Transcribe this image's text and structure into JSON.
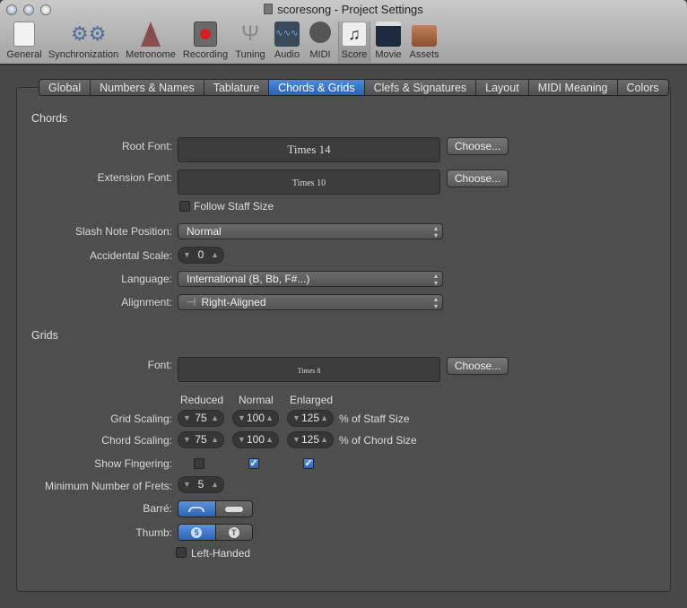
{
  "window": {
    "title": "scoresong - Project Settings"
  },
  "toolbar": [
    {
      "label": "General"
    },
    {
      "label": "Synchronization"
    },
    {
      "label": "Metronome"
    },
    {
      "label": "Recording"
    },
    {
      "label": "Tuning"
    },
    {
      "label": "Audio"
    },
    {
      "label": "MIDI"
    },
    {
      "label": "Score",
      "selected": true
    },
    {
      "label": "Movie"
    },
    {
      "label": "Assets"
    }
  ],
  "tabs": [
    {
      "label": "Global"
    },
    {
      "label": "Numbers & Names"
    },
    {
      "label": "Tablature"
    },
    {
      "label": "Chords & Grids",
      "active": true
    },
    {
      "label": "Clefs & Signatures"
    },
    {
      "label": "Layout"
    },
    {
      "label": "MIDI Meaning"
    },
    {
      "label": "Colors"
    }
  ],
  "chords": {
    "heading": "Chords",
    "root_font_label": "Root Font:",
    "root_font": "Times 14",
    "extension_font_label": "Extension Font:",
    "extension_font": "Times 10",
    "choose": "Choose...",
    "follow_staff_size": "Follow Staff Size",
    "follow_staff_size_checked": false,
    "slash_label": "Slash Note Position:",
    "slash_value": "Normal",
    "accidental_label": "Accidental Scale:",
    "accidental_value": "0",
    "language_label": "Language:",
    "language_value": "International (B, Bb, F#...)",
    "alignment_label": "Alignment:",
    "alignment_icon": "⊣",
    "alignment_value": "Right-Aligned"
  },
  "grids": {
    "heading": "Grids",
    "font_label": "Font:",
    "font_value": "Times 8",
    "choose": "Choose...",
    "col_reduced": "Reduced",
    "col_normal": "Normal",
    "col_enlarged": "Enlarged",
    "grid_scaling_label": "Grid Scaling:",
    "grid_scaling": [
      "75",
      "100",
      "125"
    ],
    "grid_scaling_unit": "% of Staff Size",
    "chord_scaling_label": "Chord Scaling:",
    "chord_scaling": [
      "75",
      "100",
      "125"
    ],
    "chord_scaling_unit": "% of Chord Size",
    "fingering_label": "Show Fingering:",
    "fingering": [
      false,
      true,
      true
    ],
    "min_frets_label": "Minimum Number of Frets:",
    "min_frets": "5",
    "barre_label": "Barré:",
    "barre_selected": 0,
    "thumb_label": "Thumb:",
    "thumb_options": [
      "5",
      "T"
    ],
    "thumb_selected": 0,
    "left_handed": "Left-Handed",
    "left_handed_checked": false
  }
}
